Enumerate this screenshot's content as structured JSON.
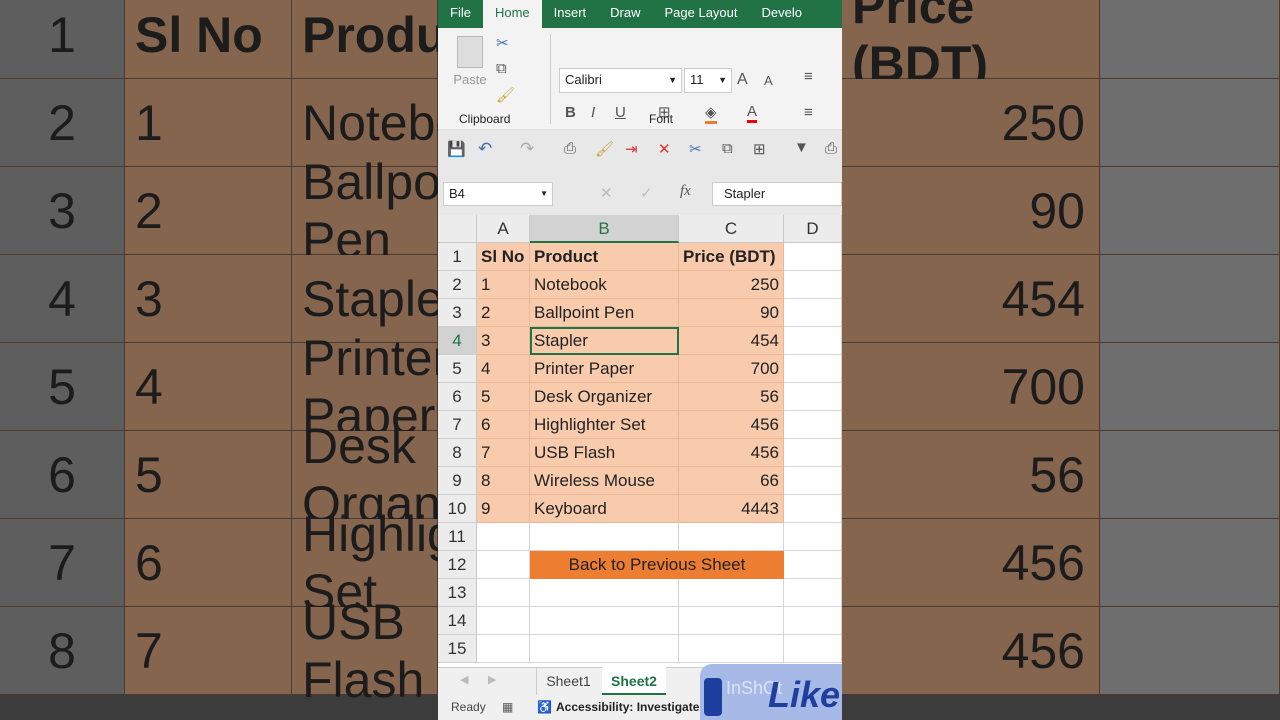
{
  "ribbon": {
    "tabs": [
      "File",
      "Home",
      "Insert",
      "Draw",
      "Page Layout",
      "Develo"
    ],
    "font_name": "Calibri",
    "font_size": "11",
    "paste_label": "Paste",
    "clipboard_label": "Clipboard",
    "font_label": "Font"
  },
  "formula_bar": {
    "name_box": "B4",
    "fx": "fx",
    "value": "Stapler"
  },
  "columns": [
    "A",
    "B",
    "C",
    "D"
  ],
  "headers": {
    "sl": "Sl No",
    "product": "Product",
    "price": "Price (BDT)"
  },
  "rows": [
    {
      "sl": "1",
      "product": "Notebook",
      "price": "250"
    },
    {
      "sl": "2",
      "product": "Ballpoint Pen",
      "price": "90"
    },
    {
      "sl": "3",
      "product": "Stapler",
      "price": "454"
    },
    {
      "sl": "4",
      "product": "Printer Paper",
      "price": "700"
    },
    {
      "sl": "5",
      "product": "Desk Organizer",
      "price": "56"
    },
    {
      "sl": "6",
      "product": "Highlighter Set",
      "price": "456"
    },
    {
      "sl": "7",
      "product": "USB Flash",
      "price": "456"
    },
    {
      "sl": "8",
      "product": "Wireless Mouse",
      "price": "66"
    },
    {
      "sl": "9",
      "product": "Keyboard",
      "price": "4443"
    }
  ],
  "row_numbers": [
    "1",
    "2",
    "3",
    "4",
    "5",
    "6",
    "7",
    "8",
    "9",
    "10",
    "11",
    "12",
    "13",
    "14",
    "15"
  ],
  "back_button": "Back to Previous Sheet",
  "sheets": [
    "Sheet1",
    "Sheet2"
  ],
  "status": {
    "ready": "Ready",
    "accessibility": "Accessibility: Investigate"
  },
  "overlay": {
    "like": "Like",
    "watermark": "InShOt"
  },
  "colors": {
    "excel_green": "#217346",
    "cell_fill": "#f8cbad",
    "button_fill": "#ed7d31"
  }
}
